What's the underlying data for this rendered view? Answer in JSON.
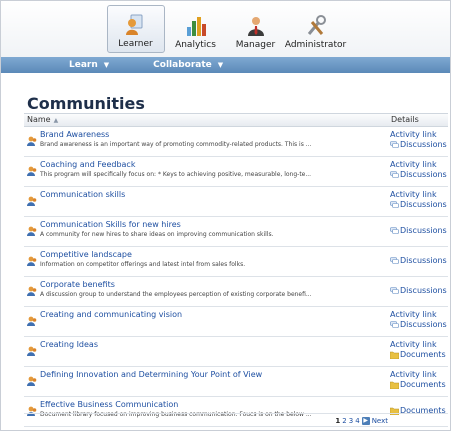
{
  "roles": [
    {
      "label": "Learner",
      "icon": "learner-icon",
      "active": true
    },
    {
      "label": "Analytics",
      "icon": "analytics-icon",
      "active": false
    },
    {
      "label": "Manager",
      "icon": "manager-icon",
      "active": false
    },
    {
      "label": "Administrator",
      "icon": "administrator-icon",
      "active": false
    }
  ],
  "nav": [
    {
      "label": "Learn"
    },
    {
      "label": "Collaborate"
    }
  ],
  "page": {
    "title": "Communities"
  },
  "table": {
    "col_name": "Name",
    "col_details": "Details",
    "rows": [
      {
        "name": "Brand Awareness",
        "desc": "Brand awareness is an important way of promoting commodity-related products. This is ...",
        "activity": "Activity link",
        "link2": "Discussions"
      },
      {
        "name": "Coaching and Feedback",
        "desc": "This program will specifically focus on: * Keys to achieving positive, measurable, long-te...",
        "activity": "Activity link",
        "link2": "Discussions"
      },
      {
        "name": "Communication skills",
        "desc": "",
        "activity": "Activity link",
        "link2": "Discussions"
      },
      {
        "name": "Communication Skills for new hires",
        "desc": "A community for new hires to share ideas on improving communication skills.",
        "activity": "",
        "link2": "Discussions"
      },
      {
        "name": "Competitive landscape",
        "desc": "Information on competitor offerings and latest intel from sales folks.",
        "activity": "",
        "link2": "Discussions"
      },
      {
        "name": "Corporate benefits",
        "desc": "A discussion group to understand the employees perception of existing corporate benefi...",
        "activity": "",
        "link2": "Discussions"
      },
      {
        "name": "Creating and communicating vision",
        "desc": "",
        "activity": "Activity link",
        "link2": "Discussions"
      },
      {
        "name": "Creating Ideas",
        "desc": "",
        "activity": "Activity link",
        "link2": "Documents"
      },
      {
        "name": "Defining Innovation and Determining Your Point of View",
        "desc": "",
        "activity": "Activity link",
        "link2": "Documents"
      },
      {
        "name": "Effective Business Communication",
        "desc": "Document library focused on improving business communication. Foucs is on the below ...",
        "activity": "",
        "link2": "Documents"
      }
    ]
  },
  "pager": {
    "pages": [
      "1",
      "2",
      "3",
      "4"
    ],
    "current": "1",
    "next": "Next"
  },
  "colors": {
    "link": "#1e4fa1",
    "nav": "#5b89b8",
    "title": "#1e2f4a"
  }
}
